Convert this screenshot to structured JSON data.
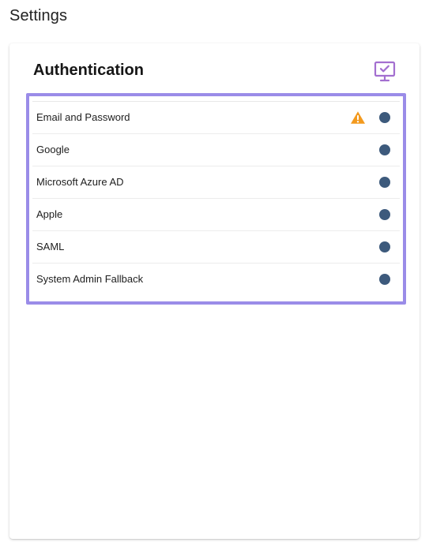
{
  "page": {
    "title": "Settings"
  },
  "authentication": {
    "title": "Authentication",
    "header_icon": "monitor-check-icon",
    "accent_color": "#9a8ce8",
    "icon_color": "#a36fd0",
    "status_dot_color": "#3d5a7c",
    "warning_color": "#f39a1e",
    "methods": [
      {
        "label": "Email and Password",
        "warning": true,
        "status_icon": "status-dot"
      },
      {
        "label": "Google",
        "warning": false,
        "status_icon": "status-dot"
      },
      {
        "label": "Microsoft Azure AD",
        "warning": false,
        "status_icon": "status-dot"
      },
      {
        "label": "Apple",
        "warning": false,
        "status_icon": "status-dot"
      },
      {
        "label": "SAML",
        "warning": false,
        "status_icon": "status-dot"
      },
      {
        "label": "System Admin Fallback",
        "warning": false,
        "status_icon": "status-dot"
      }
    ]
  }
}
